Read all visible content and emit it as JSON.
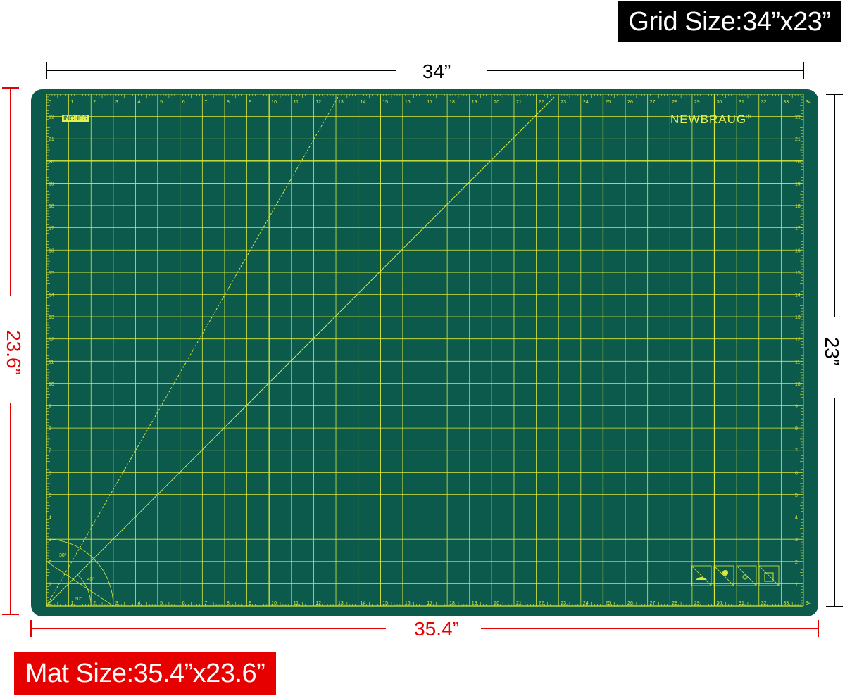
{
  "header": {
    "grid_size_label": "Grid Size:34”x23”"
  },
  "footer": {
    "mat_size_label": "Mat Size:35.4”x23.6”"
  },
  "dimensions": {
    "grid_width": "34”",
    "grid_height": "23”",
    "mat_width": "35.4”",
    "mat_height": "23.6”"
  },
  "mat": {
    "brand": "NEWBRAUG",
    "brand_mark": "®",
    "unit_label": "INCHES",
    "grid_columns": 34,
    "grid_rows": 23,
    "angle_labels": [
      "30°",
      "45°",
      "60°"
    ],
    "property_icons": [
      "self-healing-icon",
      "sun-heat-icon",
      "temperature-icon",
      "grid-icon"
    ]
  },
  "colors": {
    "mat_green": "#0c5a4c",
    "grid_line": "#d9e83a",
    "grid_badge": "#000000",
    "mat_badge": "#e60000",
    "grid_dimension": "#000000",
    "mat_dimension": "#e60000"
  }
}
